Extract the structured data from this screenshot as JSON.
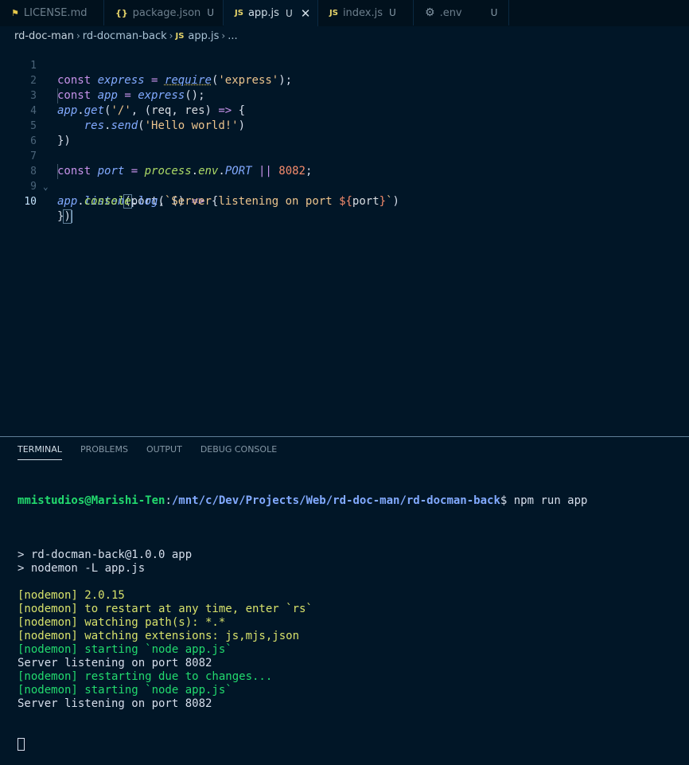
{
  "tabs": [
    {
      "icon": "license-icon",
      "icon_glyph": "⚑",
      "icon_color": "#e6c84a",
      "label": "LICENSE.md",
      "mod": ""
    },
    {
      "icon": "json-braces-icon",
      "icon_glyph": "{}",
      "icon_color": "#e6d46a",
      "label": "package.json",
      "mod": "U"
    },
    {
      "icon": "js-file-icon",
      "icon_glyph": "JS",
      "icon_color": "#e6d46a",
      "label": "app.js",
      "mod": "U"
    },
    {
      "icon": "js-file-icon",
      "icon_glyph": "JS",
      "icon_color": "#e6d46a",
      "label": "index.js",
      "mod": "U"
    },
    {
      "icon": "gear-icon",
      "icon_glyph": "⚙",
      "icon_color": "#8497a5",
      "label": ".env",
      "mod": "U"
    }
  ],
  "active_tab_close": "✕",
  "breadcrumb": {
    "root": "rd-doc-man",
    "folder": "rd-docman-back",
    "file_icon": "JS",
    "file": "app.js",
    "more": "...",
    "sep": "›"
  },
  "editor": {
    "line_numbers": [
      "1",
      "2",
      "3",
      "4",
      "5",
      "6",
      "7",
      "8",
      "9",
      "10"
    ],
    "current_line": "10"
  },
  "terminal_tabs": [
    "TERMINAL",
    "PROBLEMS",
    "OUTPUT",
    "DEBUG CONSOLE"
  ],
  "terminal": {
    "user_host": "mmistudios@Marishi-Ten",
    "colon": ":",
    "path": "/mnt/c/Dev/Projects/Web/rd-doc-man/rd-docman-back",
    "prompt": "$ npm run app",
    "lines": [
      {
        "text": "",
        "color": "plain"
      },
      {
        "text": "> rd-docman-back@1.0.0 app",
        "color": "plain"
      },
      {
        "text": "> nodemon -L app.js",
        "color": "plain"
      },
      {
        "text": "",
        "color": "plain"
      },
      {
        "text": "[nodemon] 2.0.15",
        "color": "yellow"
      },
      {
        "text": "[nodemon] to restart at any time, enter `rs`",
        "color": "yellow"
      },
      {
        "text": "[nodemon] watching path(s): *.*",
        "color": "yellow"
      },
      {
        "text": "[nodemon] watching extensions: js,mjs,json",
        "color": "yellow"
      },
      {
        "text": "[nodemon] starting `node app.js`",
        "color": "green"
      },
      {
        "text": "Server listening on port 8082",
        "color": "plain"
      },
      {
        "text": "[nodemon] restarting due to changes...",
        "color": "green"
      },
      {
        "text": "[nodemon] starting `node app.js`",
        "color": "green"
      },
      {
        "text": "Server listening on port 8082",
        "color": "plain"
      }
    ]
  },
  "colors": {
    "background": "#011627",
    "keyword": "#c792ea",
    "string": "#ecc48d",
    "function": "#82aaff",
    "number": "#f78c6c",
    "prompt_user": "#22da6e"
  }
}
